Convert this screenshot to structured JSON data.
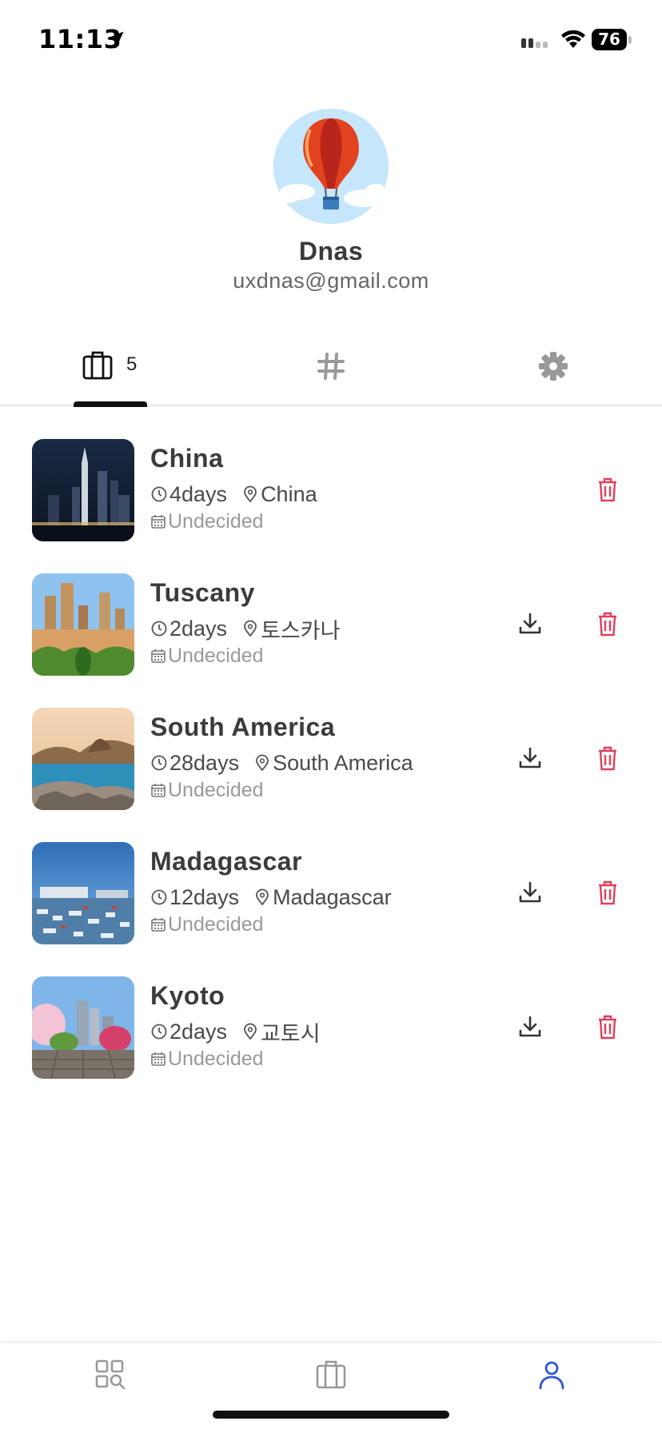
{
  "status_bar": {
    "time": "11:13",
    "battery": "76"
  },
  "profile": {
    "name": "Dnas",
    "email": "uxdnas@gmail.com",
    "avatar_icon": "hot-air-balloon-icon"
  },
  "tabs": [
    {
      "icon": "suitcase-icon",
      "count": "5",
      "active": true
    },
    {
      "icon": "hashtag-icon",
      "active": false
    },
    {
      "icon": "gear-icon",
      "active": false
    }
  ],
  "trips": [
    {
      "title": "China",
      "duration": "4days",
      "location": "China",
      "date": "Undecided",
      "has_download": false
    },
    {
      "title": "Tuscany",
      "duration": "2days",
      "location": "토스카나",
      "date": "Undecided",
      "has_download": true
    },
    {
      "title": "South America",
      "duration": "28days",
      "location": "South America",
      "date": "Undecided",
      "has_download": true
    },
    {
      "title": "Madagascar",
      "duration": "12days",
      "location": "Madagascar",
      "date": "Undecided",
      "has_download": true
    },
    {
      "title": "Kyoto",
      "duration": "2days",
      "location": "교토시",
      "date": "Undecided",
      "has_download": true
    }
  ],
  "bottom_nav": [
    {
      "icon": "explore-grid-icon",
      "active": false
    },
    {
      "icon": "suitcase-icon",
      "active": false
    },
    {
      "icon": "person-icon",
      "active": true
    }
  ],
  "colors": {
    "accent": "#2f55d4",
    "delete": "#e0405a",
    "inactive": "#9a9a9a",
    "text": "#3b3b3b"
  }
}
